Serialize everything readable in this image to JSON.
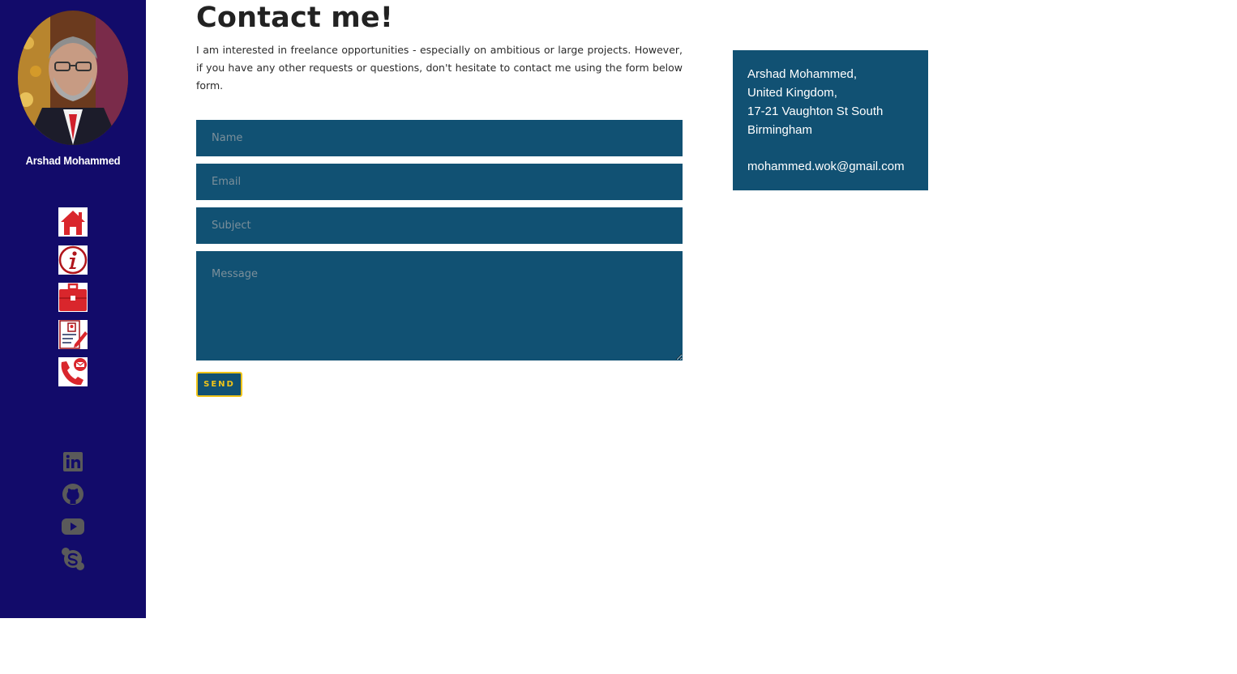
{
  "sidebar": {
    "name": "Arshad Mohammed",
    "nav": [
      {
        "name": "home",
        "icon": "home-icon"
      },
      {
        "name": "about",
        "icon": "info-icon"
      },
      {
        "name": "portfolio",
        "icon": "briefcase-icon"
      },
      {
        "name": "resume",
        "icon": "resume-icon"
      },
      {
        "name": "contact",
        "icon": "phone-mail-icon"
      }
    ],
    "social": [
      {
        "name": "linkedin",
        "icon": "linkedin-icon"
      },
      {
        "name": "github",
        "icon": "github-icon"
      },
      {
        "name": "youtube",
        "icon": "youtube-icon"
      },
      {
        "name": "skype",
        "icon": "skype-icon"
      }
    ],
    "colors": {
      "background": "#120b6a",
      "nav_icon": "#d9262c",
      "social_icon": "#5a5a5a"
    }
  },
  "main": {
    "title": "Contact me!",
    "intro": "I am interested in freelance opportunities - especially on ambitious or large projects. However, if you have any other requests or questions, don't hesitate to contact me using the form below form.",
    "form": {
      "name_placeholder": "Name",
      "email_placeholder": "Email",
      "subject_placeholder": "Subject",
      "message_placeholder": "Message",
      "send_label": "SEND"
    },
    "colors": {
      "field": "#115173",
      "accent": "#f0c419"
    }
  },
  "contact_card": {
    "line1": "Arshad Mohammed,",
    "line2": "United Kingdom,",
    "line3": "17-21 Vaughton St South",
    "line4": "Birmingham",
    "email": "mohammed.wok@gmail.com"
  }
}
